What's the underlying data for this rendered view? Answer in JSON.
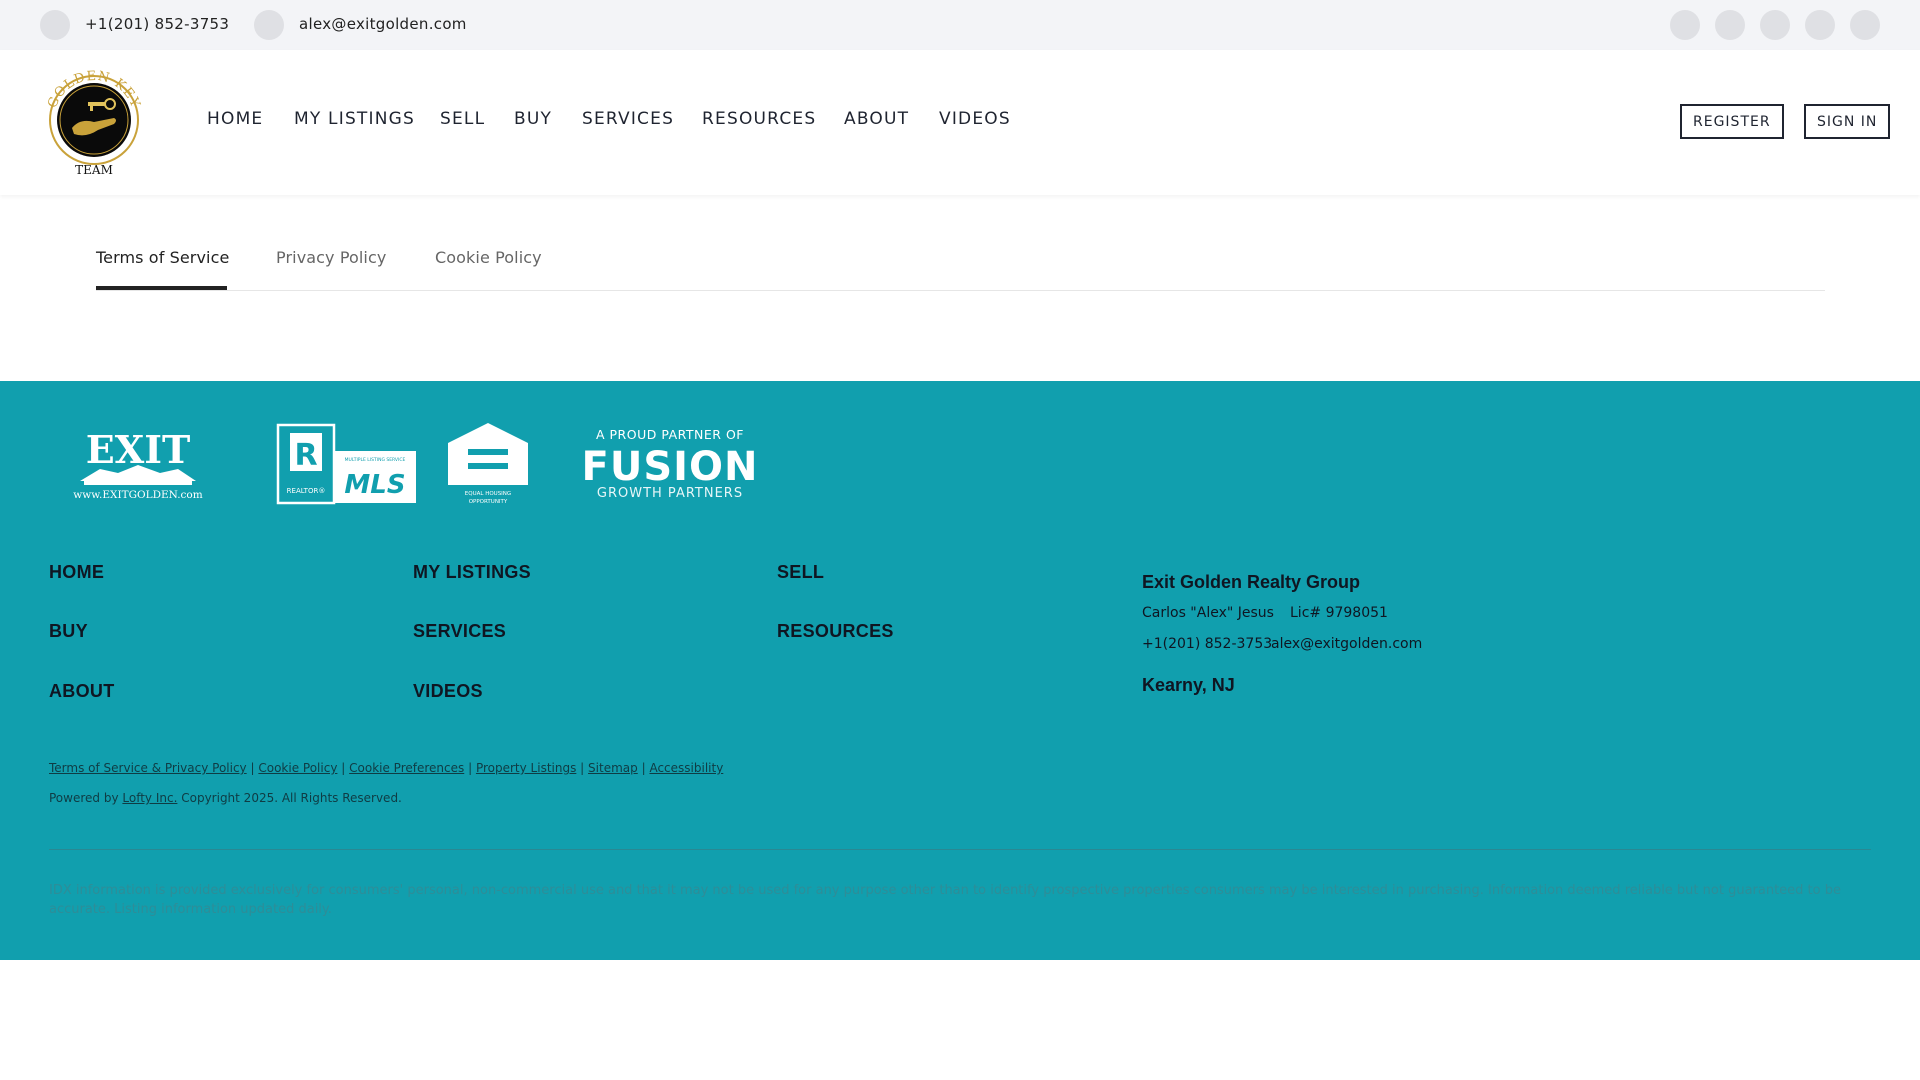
{
  "topbar": {
    "phone": "+1(201) 852-3753",
    "email": "alex@exitgolden.com",
    "social_icons": [
      "facebook-icon",
      "twitter-icon",
      "instagram-icon",
      "linkedin-icon",
      "youtube-icon"
    ]
  },
  "header": {
    "logo": {
      "alt": "Golden Key Team logo",
      "text_top": "GOLDEN KEY",
      "text_bottom": "TEAM"
    },
    "nav": [
      "HOME",
      "MY LISTINGS",
      "SELL",
      "BUY",
      "SERVICES",
      "RESOURCES",
      "ABOUT",
      "VIDEOS"
    ],
    "register_label": "REGISTER",
    "signin_label": "SIGN IN"
  },
  "tabs": {
    "items": [
      "Terms of Service",
      "Privacy Policy",
      "Cookie Policy"
    ],
    "active": "Terms of Service"
  },
  "footer": {
    "logos": {
      "exit": {
        "word": "EXIT",
        "url_text": "www.EXITGOLDEN.com"
      },
      "realtor_mls": {
        "realtor": "REALTOR®",
        "mls": "MLS",
        "mls_small": "MULTIPLE LISTING SERVICE",
        "equal_housing": "EQUAL HOUSING OPPORTUNITY"
      },
      "fusion": {
        "line1": "A PROUD PARTNER OF",
        "line2": "FUSION",
        "line3": "GROWTH PARTNERS"
      }
    },
    "nav": [
      "HOME",
      "MY LISTINGS",
      "SELL",
      "BUY",
      "SERVICES",
      "RESOURCES",
      "ABOUT",
      "VIDEOS"
    ],
    "contact": {
      "company": "Exit Golden Realty Group",
      "agent": "Carlos \"Alex\" Jesus",
      "license": "Lic# 9798051",
      "phone": "+1(201) 852-3753",
      "email": "alex@exitgolden.com",
      "location": "Kearny, NJ"
    },
    "legal_links": [
      "Terms of Service & Privacy Policy",
      "Cookie Policy",
      "Cookie Preferences",
      "Property Listings",
      "Sitemap",
      "Accessibility"
    ],
    "legal_separator": "|",
    "powered_prefix": "Powered by",
    "powered_link": "Lofty Inc.",
    "copyright": "Copyright 2025. All Rights Reserved.",
    "disclaimer": "IDX information is provided exclusively for consumers' personal, non-commercial use and that it may not be used for any purpose other than to identify prospective properties consumers may be interested in purchasing. Information deemed reliable but not guaranteed to be accurate. Listing information updated daily."
  },
  "colors": {
    "footer_bg": "#119fae",
    "topbar_bg": "#f3f4f7",
    "text_dark": "#1f2430",
    "gold": "#c9a23a"
  }
}
